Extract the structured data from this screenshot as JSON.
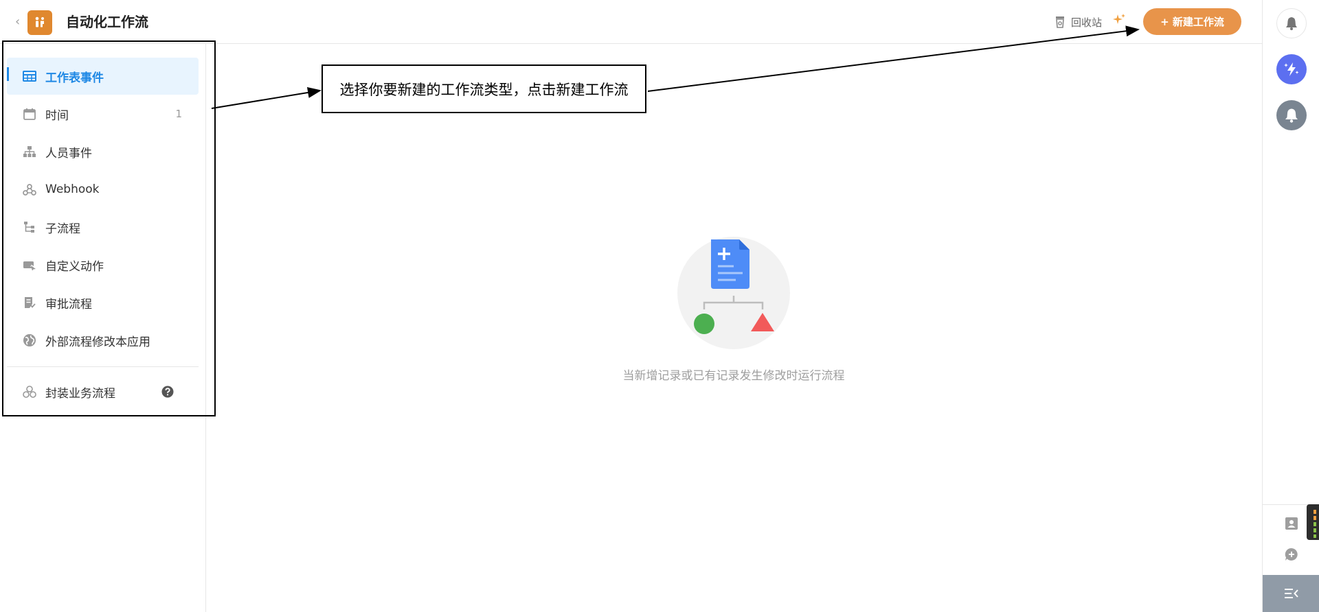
{
  "header": {
    "title": "自动化工作流",
    "recycle_label": "回收站",
    "new_button_label": "+ 新建工作流"
  },
  "sidebar": {
    "items": [
      {
        "label": "工作表事件",
        "icon": "table-icon",
        "active": true
      },
      {
        "label": "时间",
        "icon": "calendar-icon",
        "count": "1"
      },
      {
        "label": "人员事件",
        "icon": "org-chart-icon"
      },
      {
        "label": "Webhook",
        "icon": "webhook-icon"
      },
      {
        "label": "子流程",
        "icon": "subflow-icon"
      },
      {
        "label": "自定义动作",
        "icon": "custom-action-icon"
      },
      {
        "label": "审批流程",
        "icon": "approval-icon"
      },
      {
        "label": "外部流程修改本应用",
        "icon": "globe-icon"
      }
    ],
    "footer_item": {
      "label": "封装业务流程",
      "icon": "package-icon",
      "help_icon": "help-icon"
    }
  },
  "annotation": {
    "callout_text": "选择你要新建的工作流类型，点击新建工作流"
  },
  "empty_state": {
    "text": "当新增记录或已有记录发生修改时运行流程"
  },
  "colors": {
    "accent_blue": "#1e88e5",
    "brand_orange": "#e8944a",
    "logo_orange": "#e0882f",
    "rail_purple": "#5c6ff0",
    "rail_gray": "#7a8591"
  }
}
